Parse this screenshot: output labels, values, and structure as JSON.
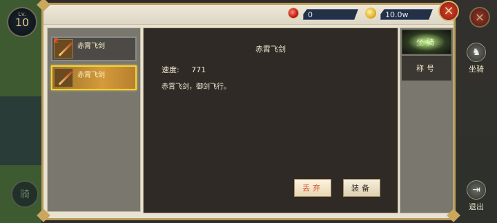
{
  "level": {
    "label": "Lv.",
    "value": "10"
  },
  "currency": {
    "gems": "0",
    "coins": "10.0w"
  },
  "items": [
    {
      "name": "赤霄飞剑",
      "tag": "E",
      "selected": false
    },
    {
      "name": "赤霄飞剑",
      "tag": "",
      "selected": true
    }
  ],
  "detail": {
    "title": "赤霄飞剑",
    "speed_label": "速度:",
    "speed_value": "771",
    "description": "赤霄飞剑，御剑飞行。",
    "drop_label": "丢弃",
    "equip_label": "装备"
  },
  "tabs": [
    {
      "label": "坐骑"
    },
    {
      "label": "称号"
    }
  ],
  "side": {
    "mount_label": "坐骑",
    "exit_label": "退出",
    "ride_label": "骑"
  },
  "icons": {
    "close": "close-x-icon",
    "gem": "ruby-icon",
    "coin": "coin-icon",
    "mount": "horse-icon",
    "exit": "exit-icon"
  }
}
